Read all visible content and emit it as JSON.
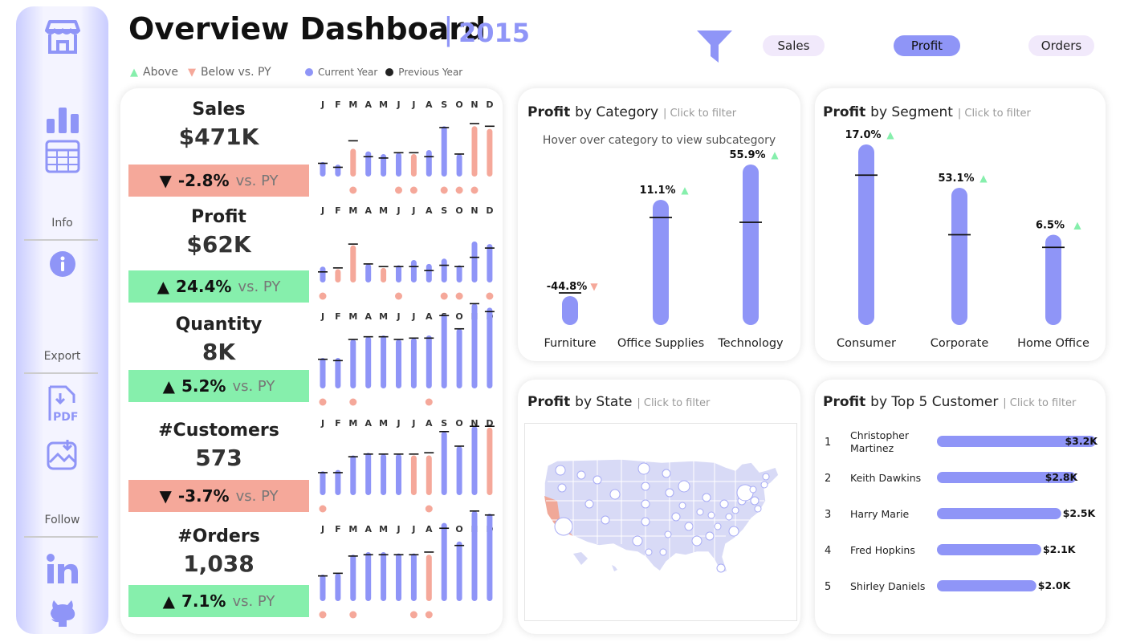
{
  "header": {
    "title": "Overview Dashboard",
    "separator": "|",
    "year": "2015"
  },
  "legend": {
    "above": "Above",
    "below": "Below vs. PY",
    "current": "Current Year",
    "previous": "Previous Year"
  },
  "filters": {
    "sales": "Sales",
    "profit": "Profit",
    "orders": "Orders"
  },
  "sidebar": {
    "info": "Info",
    "export": "Export",
    "follow": "Follow"
  },
  "colors": {
    "accent": "#8f95f7",
    "above": "#86efac",
    "below": "#f5a89a",
    "pill_light": "#f1e9fb",
    "pill_active": "#8f95f7"
  },
  "months": [
    "J",
    "F",
    "M",
    "A",
    "M",
    "J",
    "J",
    "A",
    "S",
    "O",
    "N",
    "D"
  ],
  "kpis": [
    {
      "name": "Sales",
      "value": "$471K",
      "arrow": "▼",
      "change": "-2.8%",
      "vs": "vs. PY",
      "status": "below",
      "cy": [
        0.11,
        0.09,
        0.21,
        0.19,
        0.17,
        0.18,
        0.17,
        0.2,
        0.38,
        0.17,
        0.38,
        0.36
      ],
      "py": [
        0.1,
        0.07,
        0.27,
        0.15,
        0.14,
        0.18,
        0.18,
        0.15,
        0.37,
        0.17,
        0.4,
        0.38
      ],
      "dots": [
        0,
        0,
        1,
        0,
        0,
        1,
        1,
        0,
        1,
        1,
        1,
        0
      ]
    },
    {
      "name": "Profit",
      "value": "$62K",
      "arrow": "▲",
      "change": "24.4%",
      "vs": "vs. PY",
      "status": "above",
      "cy": [
        0.12,
        0.1,
        0.28,
        0.14,
        0.11,
        0.13,
        0.17,
        0.14,
        0.18,
        0.13,
        0.31,
        0.29
      ],
      "py": [
        0.08,
        0.11,
        0.29,
        0.14,
        0.12,
        0.12,
        0.12,
        0.09,
        0.13,
        0.12,
        0.19,
        0.26
      ],
      "dots": [
        1,
        0,
        0,
        0,
        0,
        1,
        0,
        0,
        1,
        1,
        0,
        1
      ]
    },
    {
      "name": "Quantity",
      "value": "8K",
      "arrow": "▲",
      "change": "5.2%",
      "vs": "vs. PY",
      "status": "above",
      "cy": [
        0.23,
        0.23,
        0.37,
        0.39,
        0.4,
        0.37,
        0.38,
        0.4,
        0.56,
        0.45,
        0.64,
        0.61
      ],
      "py": [
        0.22,
        0.21,
        0.37,
        0.39,
        0.39,
        0.37,
        0.38,
        0.38,
        0.55,
        0.45,
        0.64,
        0.58
      ],
      "dots": [
        1,
        0,
        1,
        0,
        0,
        0,
        0,
        1,
        0,
        0,
        0,
        0
      ]
    },
    {
      "name": "#Customers",
      "value": "573",
      "arrow": "▼",
      "change": "-3.7%",
      "vs": "vs. PY",
      "status": "below",
      "cy": [
        0.18,
        0.19,
        0.3,
        0.32,
        0.31,
        0.31,
        0.3,
        0.3,
        0.48,
        0.37,
        0.52,
        0.51
      ],
      "py": [
        0.17,
        0.17,
        0.29,
        0.31,
        0.31,
        0.31,
        0.31,
        0.32,
        0.48,
        0.37,
        0.52,
        0.52
      ],
      "dots": [
        1,
        0,
        0,
        0,
        0,
        0,
        0,
        1,
        0,
        0,
        0,
        0
      ]
    },
    {
      "name": "#Orders",
      "value": "1,038",
      "arrow": "▲",
      "change": "7.1%",
      "vs": "vs. PY",
      "status": "above",
      "cy": [
        0.2,
        0.21,
        0.35,
        0.37,
        0.37,
        0.36,
        0.36,
        0.35,
        0.59,
        0.45,
        0.68,
        0.66
      ],
      "py": [
        0.19,
        0.21,
        0.34,
        0.35,
        0.35,
        0.35,
        0.35,
        0.37,
        0.55,
        0.42,
        0.68,
        0.65
      ],
      "dots": [
        1,
        0,
        1,
        0,
        0,
        0,
        1,
        1,
        0,
        0,
        0,
        0
      ]
    }
  ],
  "category": {
    "title": "Profit",
    "title_rest": "by Category",
    "sub": "| Click to filter",
    "hint": "Hover over category to view subcategory"
  },
  "segment": {
    "title": "Profit",
    "title_rest": "by Segment",
    "sub": "| Click to filter"
  },
  "state": {
    "title": "Profit",
    "title_rest": "by State",
    "sub": "| Click to filter"
  },
  "customer": {
    "title": "Profit",
    "title_rest": "by Top 5 Customer",
    "sub": "| Click to filter"
  },
  "chart_data": [
    {
      "type": "bar",
      "title": "Profit by Category",
      "categories": [
        "Furniture",
        "Office Supplies",
        "Technology"
      ],
      "values": [
        0.18,
        0.78,
        1.0
      ],
      "py_values": [
        0.2,
        0.67,
        0.64
      ],
      "change_labels": [
        "-44.8%",
        "11.1%",
        "55.9%"
      ],
      "change_dir": [
        "down",
        "up",
        "up"
      ]
    },
    {
      "type": "bar",
      "title": "Profit by Segment",
      "categories": [
        "Consumer",
        "Corporate",
        "Home Office"
      ],
      "values": [
        1.0,
        0.76,
        0.5
      ],
      "py_values": [
        0.83,
        0.5,
        0.43
      ],
      "change_labels": [
        "17.0%",
        "53.1%",
        "6.5%"
      ],
      "change_dir": [
        "up",
        "up",
        "up"
      ]
    },
    {
      "type": "bar",
      "title": "Profit by Top 5 Customer",
      "ranks": [
        "1",
        "2",
        "3",
        "4",
        "5"
      ],
      "categories": [
        "Christopher Martinez",
        "Keith Dawkins",
        "Harry Marie",
        "Fred Hopkins",
        "Shirley Daniels"
      ],
      "name_lines": [
        [
          "Christopher",
          "Martinez"
        ],
        [
          "Keith Dawkins"
        ],
        [
          "Harry Marie"
        ],
        [
          "Fred Hopkins"
        ],
        [
          "Shirley Daniels"
        ]
      ],
      "values": [
        3.2,
        2.8,
        2.5,
        2.1,
        2.0
      ],
      "labels": [
        "$3.2K",
        "$2.8K",
        "$2.5K",
        "$2.1K",
        "$2.0K"
      ]
    }
  ]
}
